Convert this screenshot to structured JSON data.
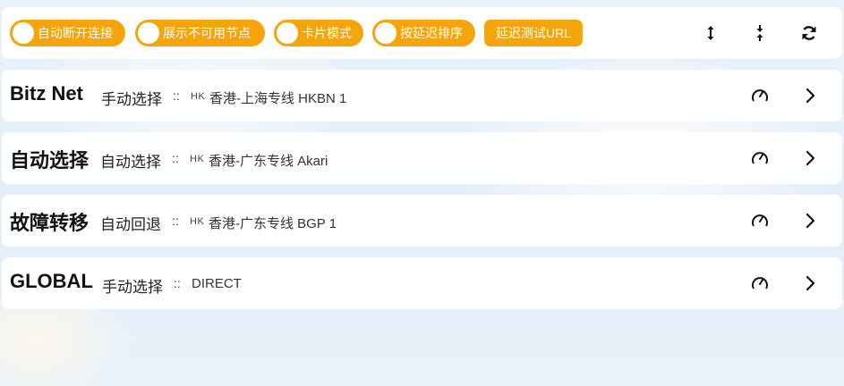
{
  "toolbar": {
    "toggles": [
      {
        "label": "自动断开连接",
        "checked": false
      },
      {
        "label": "展示不可用节点",
        "checked": false
      },
      {
        "label": "卡片模式",
        "checked": false
      },
      {
        "label": "按延迟排序",
        "checked": false
      }
    ],
    "latency_url_label": "延迟测试URL",
    "icons": [
      "expand-vertical-icon",
      "collapse-vertical-icon",
      "refresh-icon"
    ]
  },
  "colors": {
    "accent": "#f5a50c"
  },
  "groups": [
    {
      "name": "Bitz Net",
      "type": "手动选择",
      "separator": "::",
      "region": "HK",
      "node": "香港-上海专线 HKBN 1"
    },
    {
      "name": "自动选择",
      "type": "自动选择",
      "separator": "::",
      "region": "HK",
      "node": "香港-广东专线 Akari"
    },
    {
      "name": "故障转移",
      "type": "自动回退",
      "separator": "::",
      "region": "HK",
      "node": "香港-广东专线 BGP 1"
    },
    {
      "name": "GLOBAL",
      "type": "手动选择",
      "separator": "::",
      "region": "",
      "node": "DIRECT"
    }
  ]
}
